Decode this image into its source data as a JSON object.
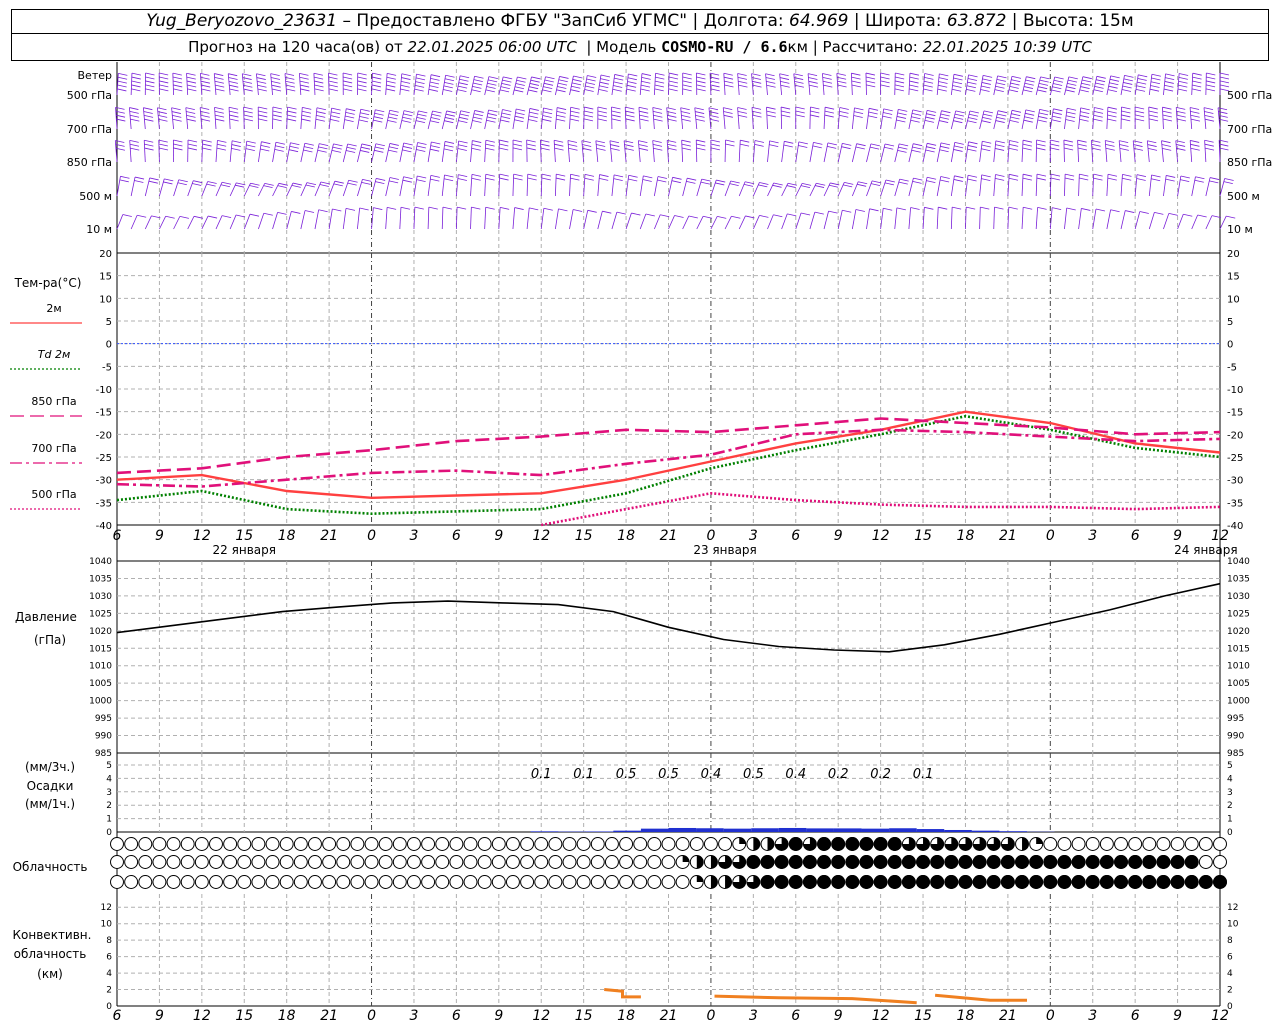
{
  "header": {
    "station": "Yug_Beryozovo_23631",
    "provider": "– Предоставлено ФГБУ \"ЗапСиб УГМС\"",
    "lon_label": "Долгота:",
    "lon": "64.969",
    "lat_label": "Широта:",
    "lat": "63.872",
    "alt_label": "Высота:",
    "alt": "15м",
    "forecast_label": "Прогноз на 120 часа(ов) от",
    "forecast_start": "22.01.2025 06:00 UTC",
    "model_label": "Модель",
    "model": "COSMO-RU / 6.6",
    "model_unit": "км",
    "calc_label": "Рассчитано:",
    "calc_time": "22.01.2025 10:39 UTC"
  },
  "labels": {
    "wind": "Ветер",
    "wind_levels": [
      "500 гПа",
      "700 гПа",
      "850 гПа",
      "500 м",
      "10  м"
    ],
    "temp": "Тем-ра(°С)",
    "temp_legend": [
      {
        "label": "2м",
        "color": "#ff4040",
        "dash": "solid"
      },
      {
        "label": "Td  2м",
        "color": "#008000",
        "dash": "dotted"
      },
      {
        "label": "850 гПа",
        "color": "#e0107a",
        "dash": "longdash"
      },
      {
        "label": "700 гПа",
        "color": "#e0107a",
        "dash": "dashdot"
      },
      {
        "label": "500 гПа",
        "color": "#e0107a",
        "dash": "dotted"
      }
    ],
    "pressure": [
      "Давление",
      "(гПа)"
    ],
    "precip": [
      "(мм/3ч.)",
      "Осадки",
      "(мм/1ч.)"
    ],
    "cloud": "Облачность",
    "conv": [
      "Конвективн.",
      "облачность",
      "(км)"
    ],
    "days": [
      "22 января",
      "23 января",
      "24 января"
    ]
  },
  "chart_data": [
    {
      "type": "line",
      "name": "temperature",
      "x_ticks": [
        "6",
        "9",
        "12",
        "15",
        "18",
        "21",
        "0",
        "3",
        "6",
        "9",
        "12",
        "15",
        "18",
        "21",
        "0",
        "3",
        "6",
        "9",
        "12",
        "15",
        "18",
        "21",
        "0",
        "3",
        "6",
        "9",
        "12"
      ],
      "ylim": [
        -40,
        20
      ],
      "yticks": [
        20,
        15,
        10,
        5,
        0,
        -5,
        -10,
        -15,
        -20,
        -25,
        -30,
        -35,
        -40
      ],
      "x": [
        0,
        6,
        12,
        18,
        24,
        30,
        36,
        42,
        48,
        54,
        60,
        66,
        72,
        78
      ],
      "series": [
        {
          "name": "2м",
          "values": [
            -30,
            -29,
            -32.5,
            -34,
            -33.5,
            -33,
            -30,
            -26,
            -22,
            -19,
            -15,
            -17.5,
            -22,
            -24
          ]
        },
        {
          "name": "Td  2м",
          "values": [
            -34.5,
            -32.5,
            -36.5,
            -37.5,
            -37,
            -36.5,
            -33,
            -27.5,
            -23.5,
            -20,
            -16,
            -19,
            -23,
            -25
          ]
        },
        {
          "name": "850 гПа",
          "values": [
            -28.5,
            -27.5,
            -25,
            -23.5,
            -21.5,
            -20.5,
            -19,
            -19.5,
            -18,
            -16.5,
            -17.5,
            -18.5,
            -20,
            -19.5
          ]
        },
        {
          "name": "700 гПа",
          "values": [
            -31,
            -31.5,
            -30,
            -28.5,
            -28,
            -29,
            -26.5,
            -24.5,
            -20,
            -19,
            -19.5,
            -20.5,
            -21.5,
            -21
          ]
        },
        {
          "name": "500 гПа",
          "values": [
            null,
            null,
            null,
            null,
            null,
            -40,
            -36.5,
            -33,
            -34.5,
            -35.5,
            -36,
            -36,
            -36.5,
            -36
          ]
        }
      ]
    },
    {
      "type": "line",
      "name": "pressure",
      "ylim": [
        985,
        1040
      ],
      "yticks": [
        1040,
        1035,
        1030,
        1025,
        1020,
        1015,
        1010,
        1005,
        1000,
        995,
        990,
        985
      ],
      "x": [
        0,
        6,
        12,
        18,
        24,
        30,
        36,
        42,
        48,
        54,
        60,
        66,
        72,
        78,
        84,
        90,
        96,
        102,
        108,
        114,
        120
      ],
      "values": [
        1019.5,
        1021.5,
        1023.5,
        1025.5,
        1026.8,
        1028,
        1028.5,
        1028,
        1027.5,
        1025.5,
        1021,
        1017.5,
        1015.5,
        1014.5,
        1014,
        1016,
        1019,
        1022.5,
        1026,
        1030,
        1033.5
      ]
    },
    {
      "type": "bar",
      "name": "precipitation",
      "ylim": [
        0,
        5
      ],
      "yticks": [
        5,
        4,
        3,
        2,
        1,
        0
      ],
      "labels_3h": [
        "0.1",
        "0.1",
        "0.5",
        "0.5",
        "0.4",
        "0.5",
        "0.4",
        "0.2",
        "0.2",
        "0.1"
      ],
      "x": [
        45,
        48,
        51,
        54,
        57,
        60,
        63,
        66,
        69,
        72,
        75,
        78,
        81,
        84,
        87,
        90,
        93,
        96,
        99
      ],
      "values": [
        0.05,
        0.03,
        0.04,
        0.1,
        0.25,
        0.3,
        0.28,
        0.25,
        0.28,
        0.3,
        0.27,
        0.27,
        0.25,
        0.28,
        0.22,
        0.15,
        0.1,
        0.06,
        0.02
      ]
    },
    {
      "type": "table",
      "name": "cloud-cover",
      "rows": [
        "high",
        "middle",
        "low"
      ],
      "high": "0000000000000000000000000000000000000000000012234344444433333333210000000000000000000000000003333344",
      "middle": "0000000000000000000000000000000000000000122334444444444444444444444444444444400000000000000000000001222233334",
      "low": "0000000000000000000000000000000000000000012233444444444444444444444444444444444444112233213121212212122322222224"
    },
    {
      "type": "line",
      "name": "convective-cloud",
      "ylim": [
        0,
        13
      ],
      "yticks": [
        12,
        10,
        8,
        6,
        4,
        2,
        0
      ],
      "segments": [
        {
          "x": [
            53,
            55,
            55,
            57
          ],
          "values": [
            2,
            1.8,
            1.1,
            1.1
          ]
        },
        {
          "x": [
            65,
            72,
            80,
            87
          ],
          "values": [
            1.2,
            1,
            0.9,
            0.4
          ]
        },
        {
          "x": [
            89,
            92,
            95,
            99
          ],
          "values": [
            1.3,
            1,
            0.7,
            0.7
          ]
        }
      ]
    }
  ]
}
